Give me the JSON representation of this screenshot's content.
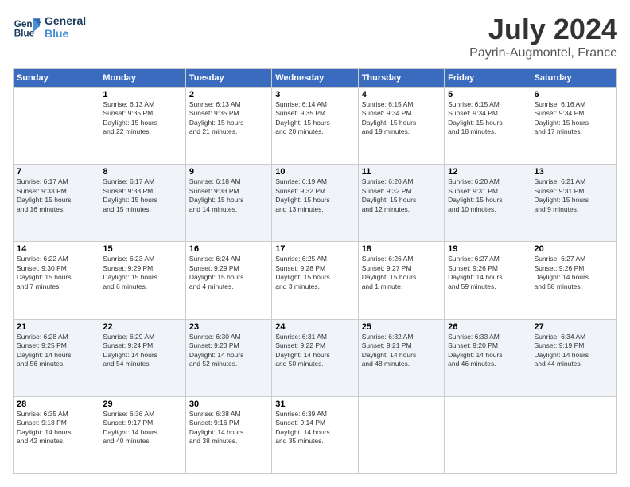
{
  "logo": {
    "line1": "General",
    "line2": "Blue"
  },
  "title": "July 2024",
  "location": "Payrin-Augmontel, France",
  "days_of_week": [
    "Sunday",
    "Monday",
    "Tuesday",
    "Wednesday",
    "Thursday",
    "Friday",
    "Saturday"
  ],
  "weeks": [
    [
      {
        "num": "",
        "info": ""
      },
      {
        "num": "1",
        "info": "Sunrise: 6:13 AM\nSunset: 9:35 PM\nDaylight: 15 hours\nand 22 minutes."
      },
      {
        "num": "2",
        "info": "Sunrise: 6:13 AM\nSunset: 9:35 PM\nDaylight: 15 hours\nand 21 minutes."
      },
      {
        "num": "3",
        "info": "Sunrise: 6:14 AM\nSunset: 9:35 PM\nDaylight: 15 hours\nand 20 minutes."
      },
      {
        "num": "4",
        "info": "Sunrise: 6:15 AM\nSunset: 9:34 PM\nDaylight: 15 hours\nand 19 minutes."
      },
      {
        "num": "5",
        "info": "Sunrise: 6:15 AM\nSunset: 9:34 PM\nDaylight: 15 hours\nand 18 minutes."
      },
      {
        "num": "6",
        "info": "Sunrise: 6:16 AM\nSunset: 9:34 PM\nDaylight: 15 hours\nand 17 minutes."
      }
    ],
    [
      {
        "num": "7",
        "info": "Sunrise: 6:17 AM\nSunset: 9:33 PM\nDaylight: 15 hours\nand 16 minutes."
      },
      {
        "num": "8",
        "info": "Sunrise: 6:17 AM\nSunset: 9:33 PM\nDaylight: 15 hours\nand 15 minutes."
      },
      {
        "num": "9",
        "info": "Sunrise: 6:18 AM\nSunset: 9:33 PM\nDaylight: 15 hours\nand 14 minutes."
      },
      {
        "num": "10",
        "info": "Sunrise: 6:19 AM\nSunset: 9:32 PM\nDaylight: 15 hours\nand 13 minutes."
      },
      {
        "num": "11",
        "info": "Sunrise: 6:20 AM\nSunset: 9:32 PM\nDaylight: 15 hours\nand 12 minutes."
      },
      {
        "num": "12",
        "info": "Sunrise: 6:20 AM\nSunset: 9:31 PM\nDaylight: 15 hours\nand 10 minutes."
      },
      {
        "num": "13",
        "info": "Sunrise: 6:21 AM\nSunset: 9:31 PM\nDaylight: 15 hours\nand 9 minutes."
      }
    ],
    [
      {
        "num": "14",
        "info": "Sunrise: 6:22 AM\nSunset: 9:30 PM\nDaylight: 15 hours\nand 7 minutes."
      },
      {
        "num": "15",
        "info": "Sunrise: 6:23 AM\nSunset: 9:29 PM\nDaylight: 15 hours\nand 6 minutes."
      },
      {
        "num": "16",
        "info": "Sunrise: 6:24 AM\nSunset: 9:29 PM\nDaylight: 15 hours\nand 4 minutes."
      },
      {
        "num": "17",
        "info": "Sunrise: 6:25 AM\nSunset: 9:28 PM\nDaylight: 15 hours\nand 3 minutes."
      },
      {
        "num": "18",
        "info": "Sunrise: 6:26 AM\nSunset: 9:27 PM\nDaylight: 15 hours\nand 1 minute."
      },
      {
        "num": "19",
        "info": "Sunrise: 6:27 AM\nSunset: 9:26 PM\nDaylight: 14 hours\nand 59 minutes."
      },
      {
        "num": "20",
        "info": "Sunrise: 6:27 AM\nSunset: 9:26 PM\nDaylight: 14 hours\nand 58 minutes."
      }
    ],
    [
      {
        "num": "21",
        "info": "Sunrise: 6:28 AM\nSunset: 9:25 PM\nDaylight: 14 hours\nand 56 minutes."
      },
      {
        "num": "22",
        "info": "Sunrise: 6:29 AM\nSunset: 9:24 PM\nDaylight: 14 hours\nand 54 minutes."
      },
      {
        "num": "23",
        "info": "Sunrise: 6:30 AM\nSunset: 9:23 PM\nDaylight: 14 hours\nand 52 minutes."
      },
      {
        "num": "24",
        "info": "Sunrise: 6:31 AM\nSunset: 9:22 PM\nDaylight: 14 hours\nand 50 minutes."
      },
      {
        "num": "25",
        "info": "Sunrise: 6:32 AM\nSunset: 9:21 PM\nDaylight: 14 hours\nand 48 minutes."
      },
      {
        "num": "26",
        "info": "Sunrise: 6:33 AM\nSunset: 9:20 PM\nDaylight: 14 hours\nand 46 minutes."
      },
      {
        "num": "27",
        "info": "Sunrise: 6:34 AM\nSunset: 9:19 PM\nDaylight: 14 hours\nand 44 minutes."
      }
    ],
    [
      {
        "num": "28",
        "info": "Sunrise: 6:35 AM\nSunset: 9:18 PM\nDaylight: 14 hours\nand 42 minutes."
      },
      {
        "num": "29",
        "info": "Sunrise: 6:36 AM\nSunset: 9:17 PM\nDaylight: 14 hours\nand 40 minutes."
      },
      {
        "num": "30",
        "info": "Sunrise: 6:38 AM\nSunset: 9:16 PM\nDaylight: 14 hours\nand 38 minutes."
      },
      {
        "num": "31",
        "info": "Sunrise: 6:39 AM\nSunset: 9:14 PM\nDaylight: 14 hours\nand 35 minutes."
      },
      {
        "num": "",
        "info": ""
      },
      {
        "num": "",
        "info": ""
      },
      {
        "num": "",
        "info": ""
      }
    ]
  ]
}
